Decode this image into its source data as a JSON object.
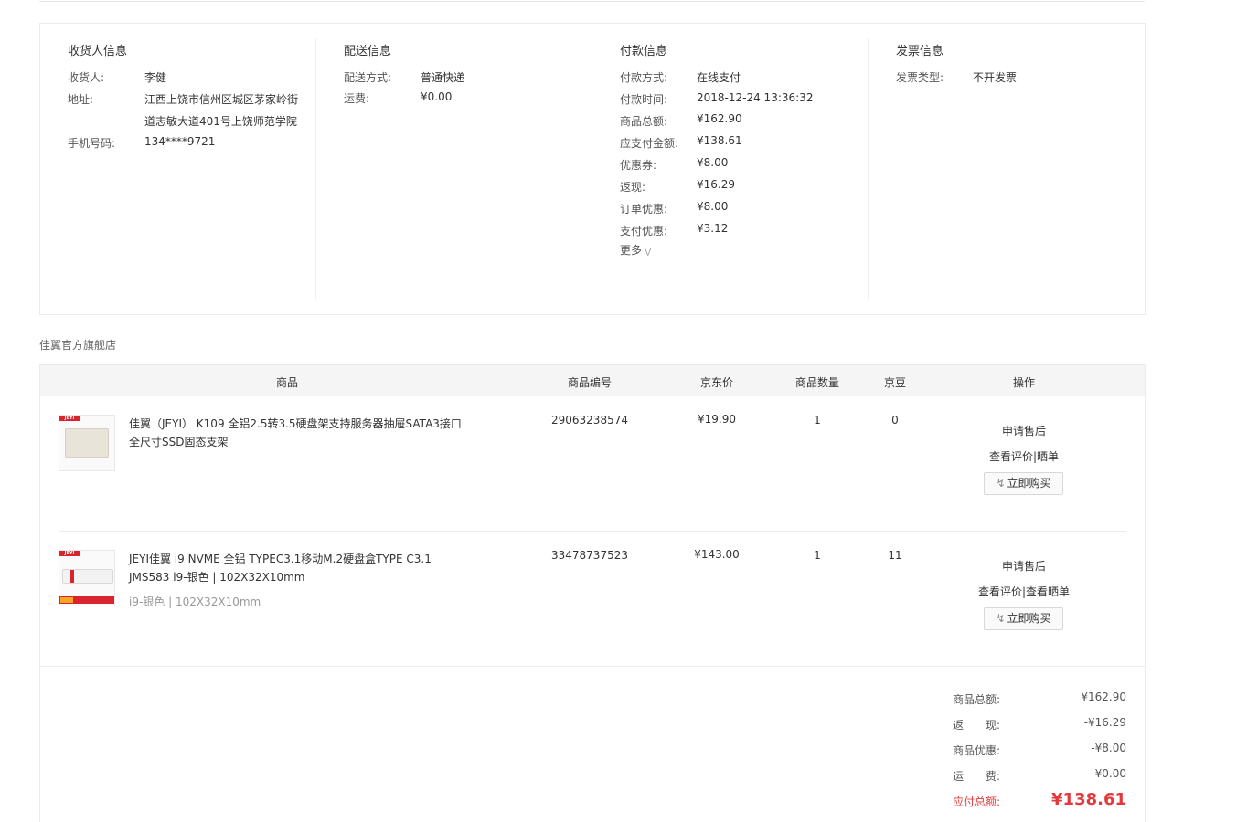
{
  "consignee": {
    "title": "收货人信息",
    "name_label": "收货人:",
    "name": "李健",
    "address_label": "地址:",
    "address_line1": "江西上饶市信州区城区茅家岭街",
    "address_line2": "道志敏大道401号上饶师范学院",
    "phone_label": "手机号码:",
    "phone": "134****9721"
  },
  "shipping": {
    "title": "配送信息",
    "method_label": "配送方式:",
    "method": "普通快递",
    "fee_label": "运费:",
    "fee": "¥0.00"
  },
  "payment": {
    "title": "付款信息",
    "rows": [
      {
        "label": "付款方式:",
        "value": "在线支付"
      },
      {
        "label": "付款时间:",
        "value": "2018-12-24 13:36:32"
      },
      {
        "label": "商品总额:",
        "value": "¥162.90"
      },
      {
        "label": "应支付金额:",
        "value": "¥138.61"
      },
      {
        "label": "优惠券:",
        "value": "¥8.00"
      },
      {
        "label": "返现:",
        "value": "¥16.29"
      },
      {
        "label": "订单优惠:",
        "value": "¥8.00"
      },
      {
        "label": "支付优惠:",
        "value": "¥3.12"
      }
    ],
    "more_label": "更多"
  },
  "invoice": {
    "title": "发票信息",
    "type_label": "发票类型:",
    "type": "不开发票"
  },
  "shop_name": "佳翼官方旗舰店",
  "table_headers": {
    "product": "商品",
    "sku": "商品编号",
    "price": "京东价",
    "quantity": "商品数量",
    "jingdou": "京豆",
    "actions": "操作"
  },
  "items": [
    {
      "name_line1": "佳翼（JEYI） K109 全铝2.5转3.5硬盘架支持服务器抽屉SATA3接口",
      "name_line2": "全尺寸SSD固态支架",
      "spec": "",
      "sku": "29063238574",
      "price": "¥19.90",
      "quantity": "1",
      "jingdou": "0",
      "after_sale": "申请售后",
      "review": "查看评价|晒单",
      "buy": "立即购买",
      "brand": "JEYI"
    },
    {
      "name_line1": "JEYI佳翼 i9 NVME 全铝 TYPEC3.1移动M.2硬盘盒TYPE C3.1",
      "name_line2": "JMS583 i9-银色 | 102X32X10mm",
      "spec": "i9-银色 | 102X32X10mm",
      "sku": "33478737523",
      "price": "¥143.00",
      "quantity": "1",
      "jingdou": "11",
      "after_sale": "申请售后",
      "review": "查看评价|查看晒单",
      "buy": "立即购买",
      "brand": "JEYI"
    }
  ],
  "summary": {
    "goods_total_label": "商品总额:",
    "goods_total": "¥162.90",
    "cashback_label": "返　　现:",
    "cashback": "-¥16.29",
    "discount_label": "商品优惠:",
    "discount": "-¥8.00",
    "freight_label": "运　　费:",
    "freight": "¥0.00",
    "payable_label": "应付总额:",
    "payable": "¥138.61"
  },
  "colors": {
    "accent_red": "#e4393c",
    "brand_red": "#d9232d"
  }
}
